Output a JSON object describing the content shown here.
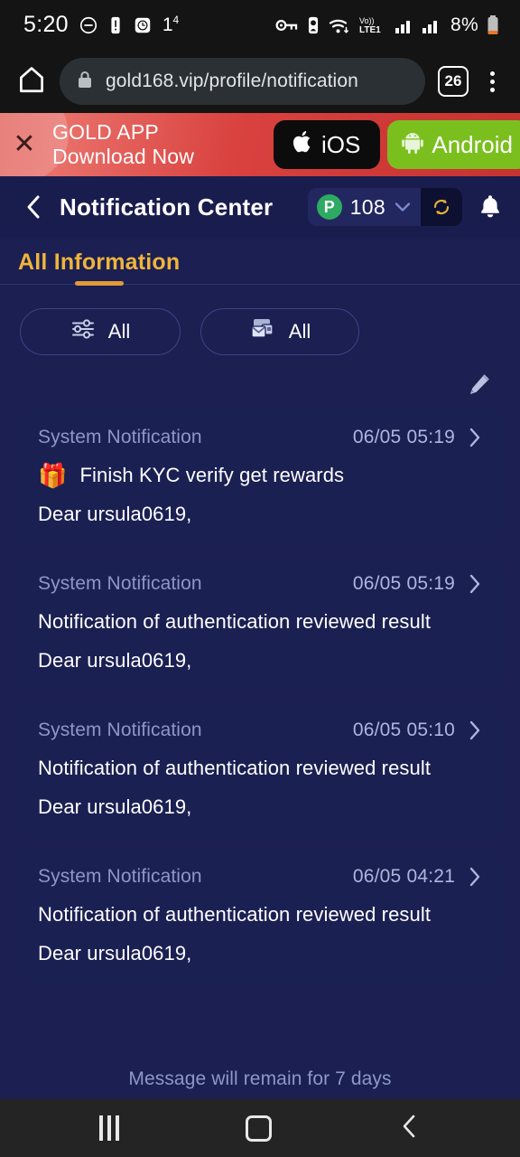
{
  "statusbar": {
    "time": "5:20",
    "temperature": "1",
    "temperature_unit": "4",
    "battery_percent": "8%",
    "network_label": "Vo))",
    "network_label2": "LTE1",
    "icons": [
      "dnd-icon",
      "battery-saver-icon",
      "alarm-icon",
      "vpn-key-icon",
      "nfc-icon",
      "wifi-icon",
      "volte-icon",
      "signal-bars-icon",
      "signal-bars-icon-2",
      "battery-icon"
    ]
  },
  "browser": {
    "home_icon": "home-icon",
    "lock_icon": "lock-icon",
    "url": "gold168.vip/profile/notification",
    "tab_count": "26",
    "menu_icon": "kebab-menu-icon"
  },
  "banner": {
    "close_label": "✕",
    "line1": "GOLD APP",
    "line2": "Download Now",
    "ios_label": "iOS",
    "android_label": "Android",
    "ios_bg": "#0c0c0c",
    "android_bg": "#7bbf1f"
  },
  "header": {
    "back_icon": "back-chevron-icon",
    "title": "Notification Center",
    "points_badge": "P",
    "points_value": "108",
    "chevron": "⌄",
    "refresh_icon": "refresh-icon",
    "bell_icon": "bell-icon",
    "accent": "#f0b43c"
  },
  "tabs": [
    {
      "label": "All Information",
      "active": true
    }
  ],
  "filters": [
    {
      "label": "All",
      "icon": "sliders-filter-icon"
    },
    {
      "label": "All",
      "icon": "mail-stack-icon"
    }
  ],
  "edit": {
    "icon": "pencil-edit-icon"
  },
  "notifications": [
    {
      "source": "System Notification",
      "time": "06/05 05:19",
      "emoji": "🎁",
      "title": "Finish KYC verify get rewards",
      "body": "Dear ursula0619,"
    },
    {
      "source": "System Notification",
      "time": "06/05 05:19",
      "emoji": "",
      "title": "Notification of authentication reviewed result",
      "body": "Dear ursula0619,"
    },
    {
      "source": "System Notification",
      "time": "06/05 05:10",
      "emoji": "",
      "title": "Notification of authentication reviewed result",
      "body": "Dear ursula0619,"
    },
    {
      "source": "System Notification",
      "time": "06/05 04:21",
      "emoji": "",
      "title": "Notification of authentication reviewed result",
      "body": "Dear ursula0619,"
    }
  ],
  "footer": {
    "note": "Message will remain for 7 days"
  },
  "navbar": {
    "recents": "recents-icon",
    "home": "home-square-icon",
    "back": "back-icon"
  }
}
